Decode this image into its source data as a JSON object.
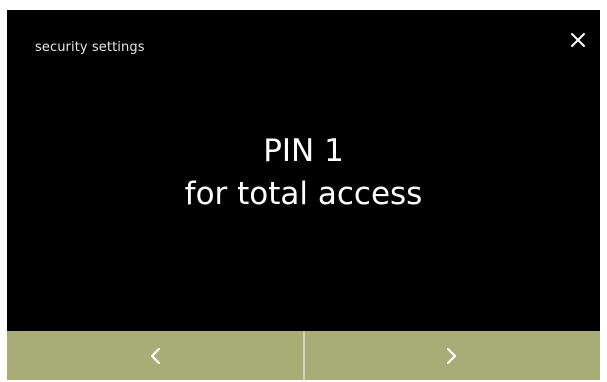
{
  "header": {
    "title": "security settings"
  },
  "message": {
    "line1": "PIN 1",
    "line2": "for total access"
  },
  "icons": {
    "close": "close-icon",
    "previous": "chevron-left-icon",
    "next": "chevron-right-icon"
  },
  "colors": {
    "screen_background": "#000000",
    "text": "#ffffff",
    "nav_button": "#a8ac77",
    "nav_divider": "#d4d7b2"
  }
}
